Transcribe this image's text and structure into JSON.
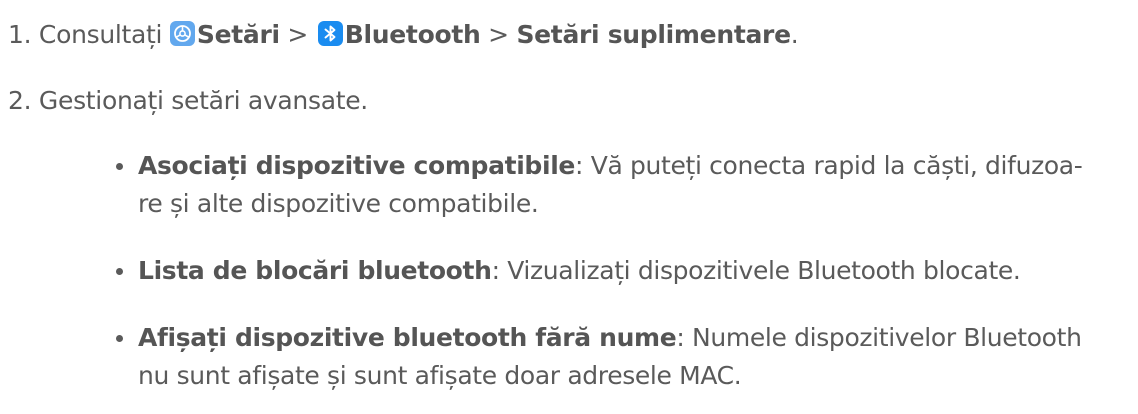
{
  "step1": {
    "number": "1.",
    "prefix": "Consultați",
    "settings_label": "Setări",
    "separator1": ">",
    "bluetooth_label": "Bluetooth",
    "separator2": ">",
    "extra_label": "Setări suplimentare",
    "end": "."
  },
  "step2": {
    "number": "2.",
    "text": "Gestionați setări avansate."
  },
  "bullets": [
    {
      "title": "Asociați dispozitive compatibile",
      "line1": ": Vă puteți conecta rapid la căști, difuzoa-",
      "line2": "re și alte dispozitive compatibile."
    },
    {
      "title": "Lista de blocări bluetooth",
      "line1": ": Vizualizați dispozitivele Bluetooth blocate.",
      "line2": ""
    },
    {
      "title": "Afișați dispozitive bluetooth fără nume",
      "line1": ": Numele dispozitivelor Bluetooth",
      "line2": "nu sunt afișate și sunt afișate doar adresele MAC."
    }
  ],
  "icons": {
    "settings": "settings-gear-icon",
    "bluetooth": "bluetooth-icon"
  },
  "colors": {
    "text": "#5a5a5a",
    "settings_icon_bg": "#62a8ee",
    "bluetooth_icon_bg": "#1a8cf0"
  }
}
